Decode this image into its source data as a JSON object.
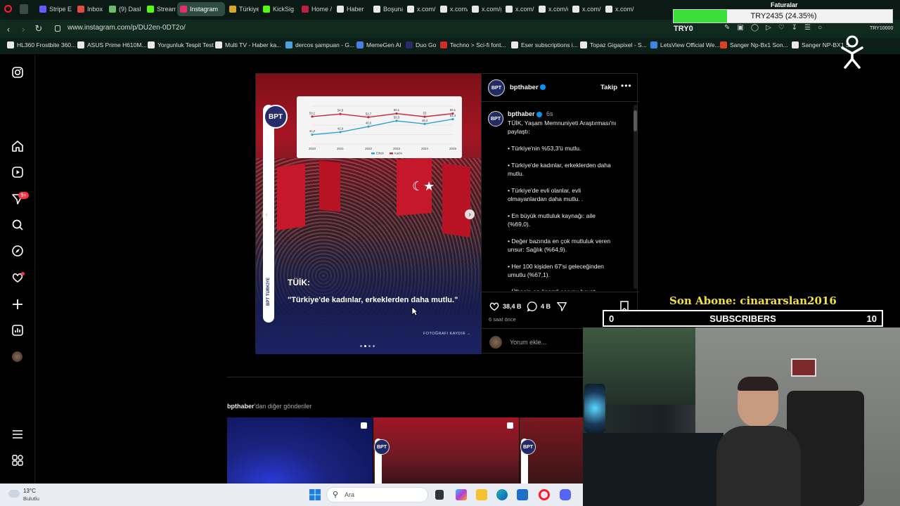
{
  "browser": {
    "tabs": [
      {
        "label": "Stripe E",
        "color": "#635bff"
      },
      {
        "label": "Inbox (",
        "color": "#e04f3b"
      },
      {
        "label": "(9) Dasl",
        "color": "#6dbb6d"
      },
      {
        "label": "Stream",
        "color": "#53fc18"
      },
      {
        "label": "Instagram",
        "color": "#e1306c"
      },
      {
        "label": "Türkiye",
        "color": "#d8a530"
      },
      {
        "label": "KickSig",
        "color": "#53fc18"
      },
      {
        "label": "Home /",
        "color": "#c02040"
      },
      {
        "label": "Haber",
        "color": "#e7e7e7"
      },
      {
        "label": "Boşuna",
        "color": "#e7e7e7"
      },
      {
        "label": "x.com/",
        "color": "#e7e7e7"
      },
      {
        "label": "x.com/",
        "color": "#e7e7e7"
      },
      {
        "label": "x.com/g",
        "color": "#e7e7e7"
      },
      {
        "label": "x.com/",
        "color": "#e7e7e7"
      },
      {
        "label": "x.com/c",
        "color": "#e7e7e7"
      },
      {
        "label": "x.com/",
        "color": "#e7e7e7"
      },
      {
        "label": "x.com/",
        "color": "#e7e7e7"
      }
    ],
    "url": "www.instagram.com/p/DU2en-0DT2o/",
    "bookmarks": [
      {
        "label": "HL360 Frostbite 360...",
        "color": "#e8e8e8"
      },
      {
        "label": "ASUS Prime H610M...",
        "color": "#e8e8e8"
      },
      {
        "label": "Yorgunluk Tespit Test",
        "color": "#e8e8e8"
      },
      {
        "label": "Multi TV - Haber ka...",
        "color": "#e8e8e8"
      },
      {
        "label": "dercos şampuan - G...",
        "color": "#4aa3df"
      },
      {
        "label": "MemeGen AI",
        "color": "#4f7ddb"
      },
      {
        "label": "Duo Go",
        "color": "#2b2b6a"
      },
      {
        "label": "Techno > Sci-fi font...",
        "color": "#d12b2b"
      },
      {
        "label": "Eser subscriptions i...",
        "color": "#e8e8e8"
      },
      {
        "label": "Topaz Gigapixel - S...",
        "color": "#e8e8e8"
      },
      {
        "label": "LetsView Official We...",
        "color": "#3a86e0"
      },
      {
        "label": "Sanger Np-Bx1 Son...",
        "color": "#d9441f"
      },
      {
        "label": "Sanger NP-BX1 S...",
        "color": "#e8e8e8"
      }
    ]
  },
  "nav": {
    "badge_count": "9+"
  },
  "post": {
    "username": "bpthaber",
    "follow_label": "Takip",
    "caption_username": "bpthaber",
    "caption_time": "6s",
    "caption_lines": [
      "TÜİK, Yaşam Memnuniyeti Araştırması'nı",
      "paylaştı:",
      "",
      "• Türkiye'nin %53,3'ü mutlu.",
      "",
      "• Türkiye'de kadınlar, erkeklerden daha",
      "mutlu.",
      "",
      "• Türkiye'de evli olanlar, evli",
      "olmayanlardan daha mutlu. .",
      "",
      "• En büyük mutluluk kaynağı: aile",
      "(%69,0).",
      "",
      "• Değer bazında en çok mutluluk veren",
      "unsur: Sağlık (%64,9).",
      "",
      "• Her 100 kişiden 67'si geleceğinden",
      "umutlu (%67,1).",
      "",
      "• Ülkenin en önemli sorunu hayat"
    ],
    "likes": "38,4 B",
    "comments": "4 B",
    "time_ago": "6 saat önce",
    "comment_placeholder": "Yorum ekle...",
    "image_title": "TÜİK:",
    "image_quote": "\"Türkiye'de kadınlar, erkeklerden daha mutlu.\"",
    "photo_credit": "FOTOĞRAFI KAYDIR →",
    "logo_text": "BPT",
    "vertical_label": "BPT TÜRKİYE",
    "more_posts_user": "bpthaber",
    "more_posts_suffix": "'dan diğer gönderiler"
  },
  "chart_data": {
    "type": "line",
    "x": [
      "2020",
      "2021",
      "2022",
      "2023",
      "2024",
      "2025"
    ],
    "series": [
      {
        "name": "Erkek",
        "color": "#2f9fd8",
        "values": [
          41.2,
          42.9,
          46.5,
          50.3,
          48.3,
          51.4
        ]
      },
      {
        "name": "Kadın",
        "color": "#c8283c",
        "values": [
          53.1,
          54.8,
          52.7,
          55.1,
          53.0,
          55.1
        ]
      }
    ],
    "ylim": [
      35,
      60
    ]
  },
  "overlays": {
    "donation_text": "TRY2435 (24.35%)",
    "donation_fraction": 0.2435,
    "goal_start": "TRY0",
    "goal_end": "TRY10000",
    "faturalar": "Faturalar",
    "last_sub": "Son Abone: cinararslan2016",
    "subs_left": "0",
    "subs_label": "SUBSCRIBERS",
    "subs_right": "10"
  },
  "taskbar": {
    "weather_temp": "13°C",
    "weather_desc": "Bulutlu",
    "search_placeholder": "Ara"
  }
}
